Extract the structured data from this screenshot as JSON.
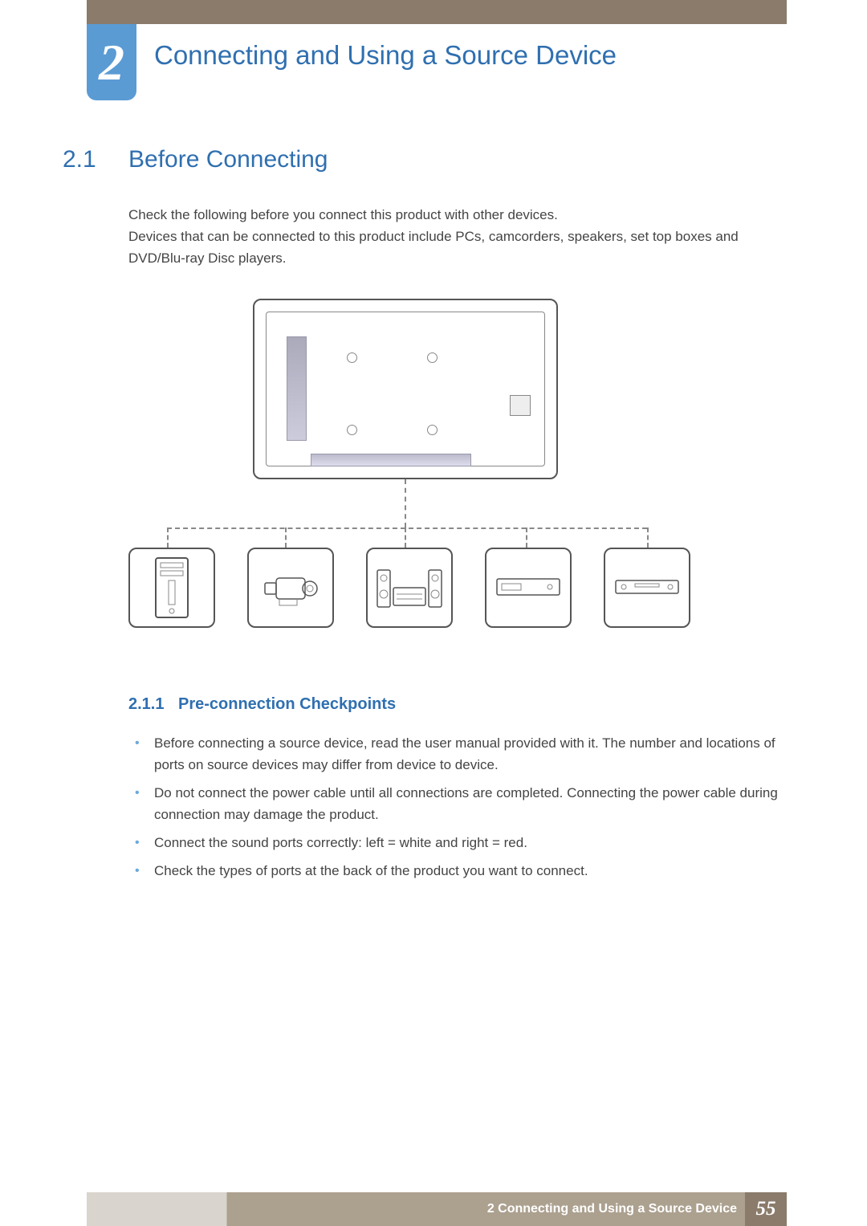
{
  "chapter": {
    "number": "2",
    "title": "Connecting and Using a Source Device"
  },
  "section": {
    "number": "2.1",
    "title": "Before Connecting",
    "intro_line1": "Check the following before you connect this product with other devices.",
    "intro_line2": "Devices that can be connected to this product include PCs, camcorders, speakers, set top boxes and DVD/Blu-ray Disc players."
  },
  "subsection": {
    "number": "2.1.1",
    "title": "Pre-connection Checkpoints",
    "bullets": [
      "Before connecting a source device, read the user manual provided with it. The number and locations of ports on source devices may differ from device to device.",
      "Do not connect the power cable until all connections are completed. Connecting the power cable during connection may damage the product.",
      "Connect the sound ports correctly: left = white and right = red.",
      "Check the types of ports at the back of the product you want to connect."
    ]
  },
  "footer": {
    "chapter_ref": "2 Connecting and Using a Source Device",
    "page": "55"
  },
  "devices": [
    "pc-tower",
    "camcorder",
    "speaker-amp",
    "set-top-box",
    "bluray-player"
  ]
}
